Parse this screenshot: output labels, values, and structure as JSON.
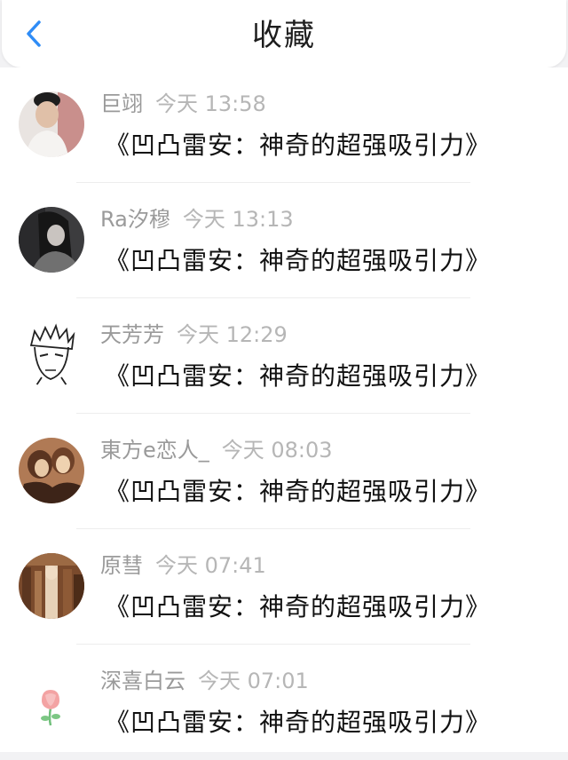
{
  "header": {
    "title": "收藏"
  },
  "items": [
    {
      "name": "巨翊",
      "time": "今天 13:58",
      "content": "《凹凸雷安：神奇的超强吸引力》"
    },
    {
      "name": "Ra汐穆",
      "time": "今天 13:13",
      "content": "《凹凸雷安：神奇的超强吸引力》"
    },
    {
      "name": "天芳芳",
      "time": "今天 12:29",
      "content": "《凹凸雷安：神奇的超强吸引力》"
    },
    {
      "name": "東方e恋人_",
      "time": "今天 08:03",
      "content": "《凹凸雷安：神奇的超强吸引力》"
    },
    {
      "name": "原彗",
      "time": "今天 07:41",
      "content": "《凹凸雷安：神奇的超强吸引力》"
    },
    {
      "name": "深喜白云",
      "time": "今天 07:01",
      "content": "《凹凸雷安：神奇的超强吸引力》"
    }
  ],
  "colors": {
    "accent": "#2f8cf6",
    "background": "#f2f2f4",
    "name_text": "#9a9a9a",
    "content_text": "#111111"
  },
  "icons": {
    "back": "chevron-left-icon"
  }
}
